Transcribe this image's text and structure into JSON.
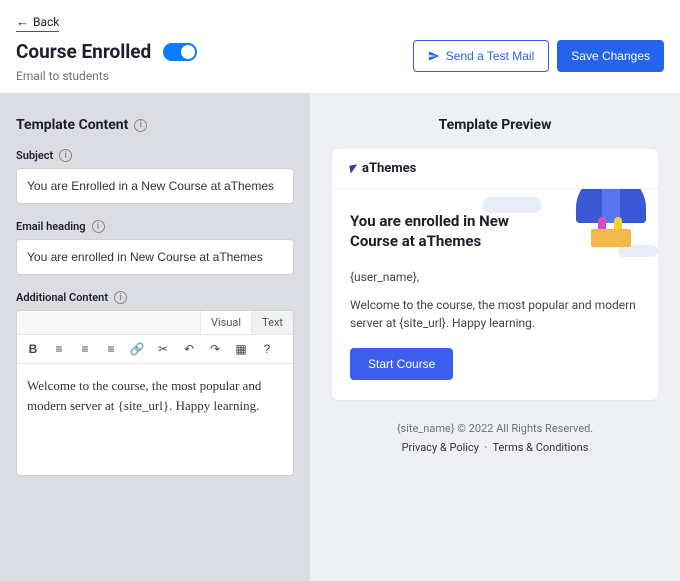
{
  "back": "Back",
  "title": "Course Enrolled",
  "subtitle": "Email to students",
  "buttons": {
    "test": "Send a Test Mail",
    "save": "Save Changes"
  },
  "left": {
    "title": "Template Content",
    "subjectLabel": "Subject",
    "subject": "You are Enrolled in a New Course at aThemes",
    "headingLabel": "Email heading",
    "heading": "You are enrolled in New Course at aThemes",
    "additionalLabel": "Additional Content",
    "tabs": {
      "visual": "Visual",
      "text": "Text"
    },
    "body": "Welcome to the course, the most popular and modern server at {site_url}. Happy learning."
  },
  "preview": {
    "title": "Template Preview",
    "brand": "aThemes",
    "heroTitle": "You are enrolled in New Course at aThemes",
    "greeting": "{user_name},",
    "body": "Welcome to the course, the most popular and modern server at {site_url}. Happy learning.",
    "cta": "Start Course",
    "footer": "{site_name} © 2022 All Rights Reserved.",
    "privacy": "Privacy & Policy",
    "terms": "Terms & Conditions"
  }
}
